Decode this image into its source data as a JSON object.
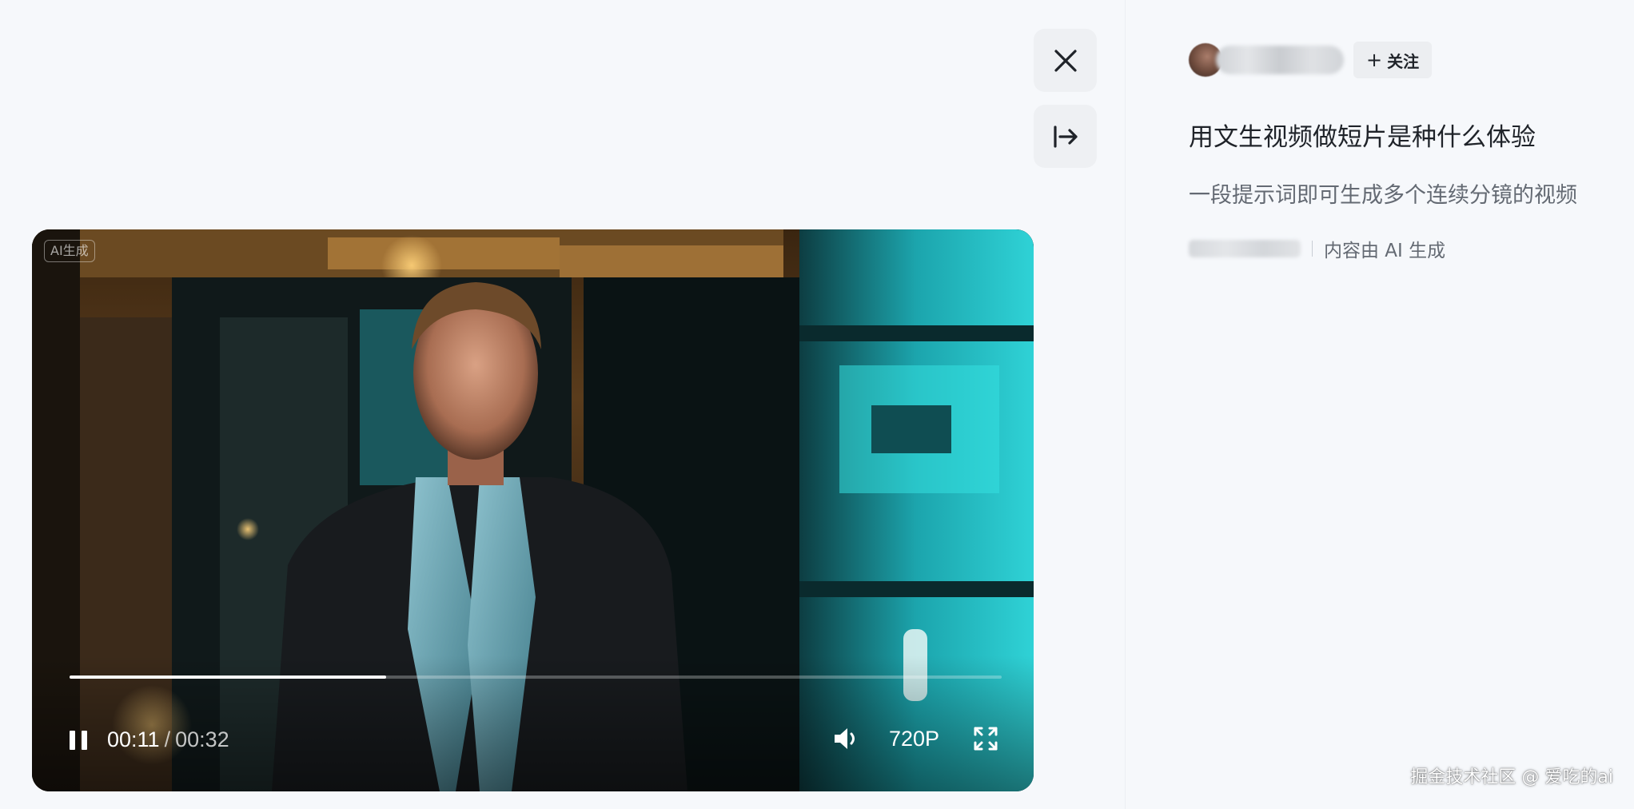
{
  "player": {
    "ai_tag": "AI生成",
    "current_time": "00:11",
    "time_separator": "/",
    "duration": "00:32",
    "progress": 0.34,
    "quality": "720P",
    "icons": {
      "play_state": "pause-icon",
      "volume": "volume-icon",
      "fullscreen": "fullscreen-icon"
    }
  },
  "actions": {
    "close_icon": "close-icon",
    "collapse_icon": "collapse-panel-icon"
  },
  "author": {
    "follow_plus": "+",
    "follow_label": "关注"
  },
  "post": {
    "title": "用文生视频做短片是种什么体验",
    "description": "一段提示词即可生成多个连续分镜的视频",
    "ai_note": "内容由 AI 生成"
  },
  "watermark": "掘金技术社区 @ 爱吃的ai",
  "colors": {
    "page_background": "#f6f8fb",
    "button_background": "#eef0f3",
    "primary_text": "#1f2329",
    "secondary_text": "#646a73"
  }
}
